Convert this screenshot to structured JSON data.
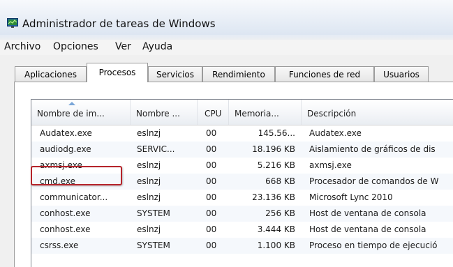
{
  "window": {
    "title": "Administrador de tareas de Windows"
  },
  "menu": [
    "Archivo",
    "Opciones",
    "Ver",
    "Ayuda"
  ],
  "tabs": [
    "Aplicaciones",
    "Procesos",
    "Servicios",
    "Rendimiento",
    "Funciones de red",
    "Usuarios"
  ],
  "active_tab": "Procesos",
  "columns": [
    "Nombre de im...",
    "Nombre ...",
    "CPU",
    "Memoria...",
    "Descripción"
  ],
  "rows": [
    {
      "name": "Audatex.exe",
      "user": "eslnzj",
      "cpu": "00",
      "memory": "145.56...",
      "desc": "Audatex.exe"
    },
    {
      "name": "audiodg.exe",
      "user": "SERVIC...",
      "cpu": "00",
      "memory": "18.196 KB",
      "desc": "Aislamiento de gráficos de dis"
    },
    {
      "name": "axmsj.exe",
      "user": "eslnzj",
      "cpu": "00",
      "memory": "5.216 KB",
      "desc": "axmsj.exe"
    },
    {
      "name": "cmd.exe",
      "user": "eslnzj",
      "cpu": "00",
      "memory": "668 KB",
      "desc": "Procesador de comandos de W"
    },
    {
      "name": "communicator...",
      "user": "eslnzj",
      "cpu": "00",
      "memory": "23.136 KB",
      "desc": "Microsoft Lync 2010"
    },
    {
      "name": "conhost.exe",
      "user": "SYSTEM",
      "cpu": "00",
      "memory": "256 KB",
      "desc": "Host de ventana de consola"
    },
    {
      "name": "conhost.exe",
      "user": "eslnzj",
      "cpu": "00",
      "memory": "3.444 KB",
      "desc": "Host de ventana de consola"
    },
    {
      "name": "csrss.exe",
      "user": "SYSTEM",
      "cpu": "00",
      "memory": "1.100 KB",
      "desc": "Proceso en tiempo de ejecució"
    }
  ],
  "colors": {
    "highlight": "#b5232a"
  }
}
